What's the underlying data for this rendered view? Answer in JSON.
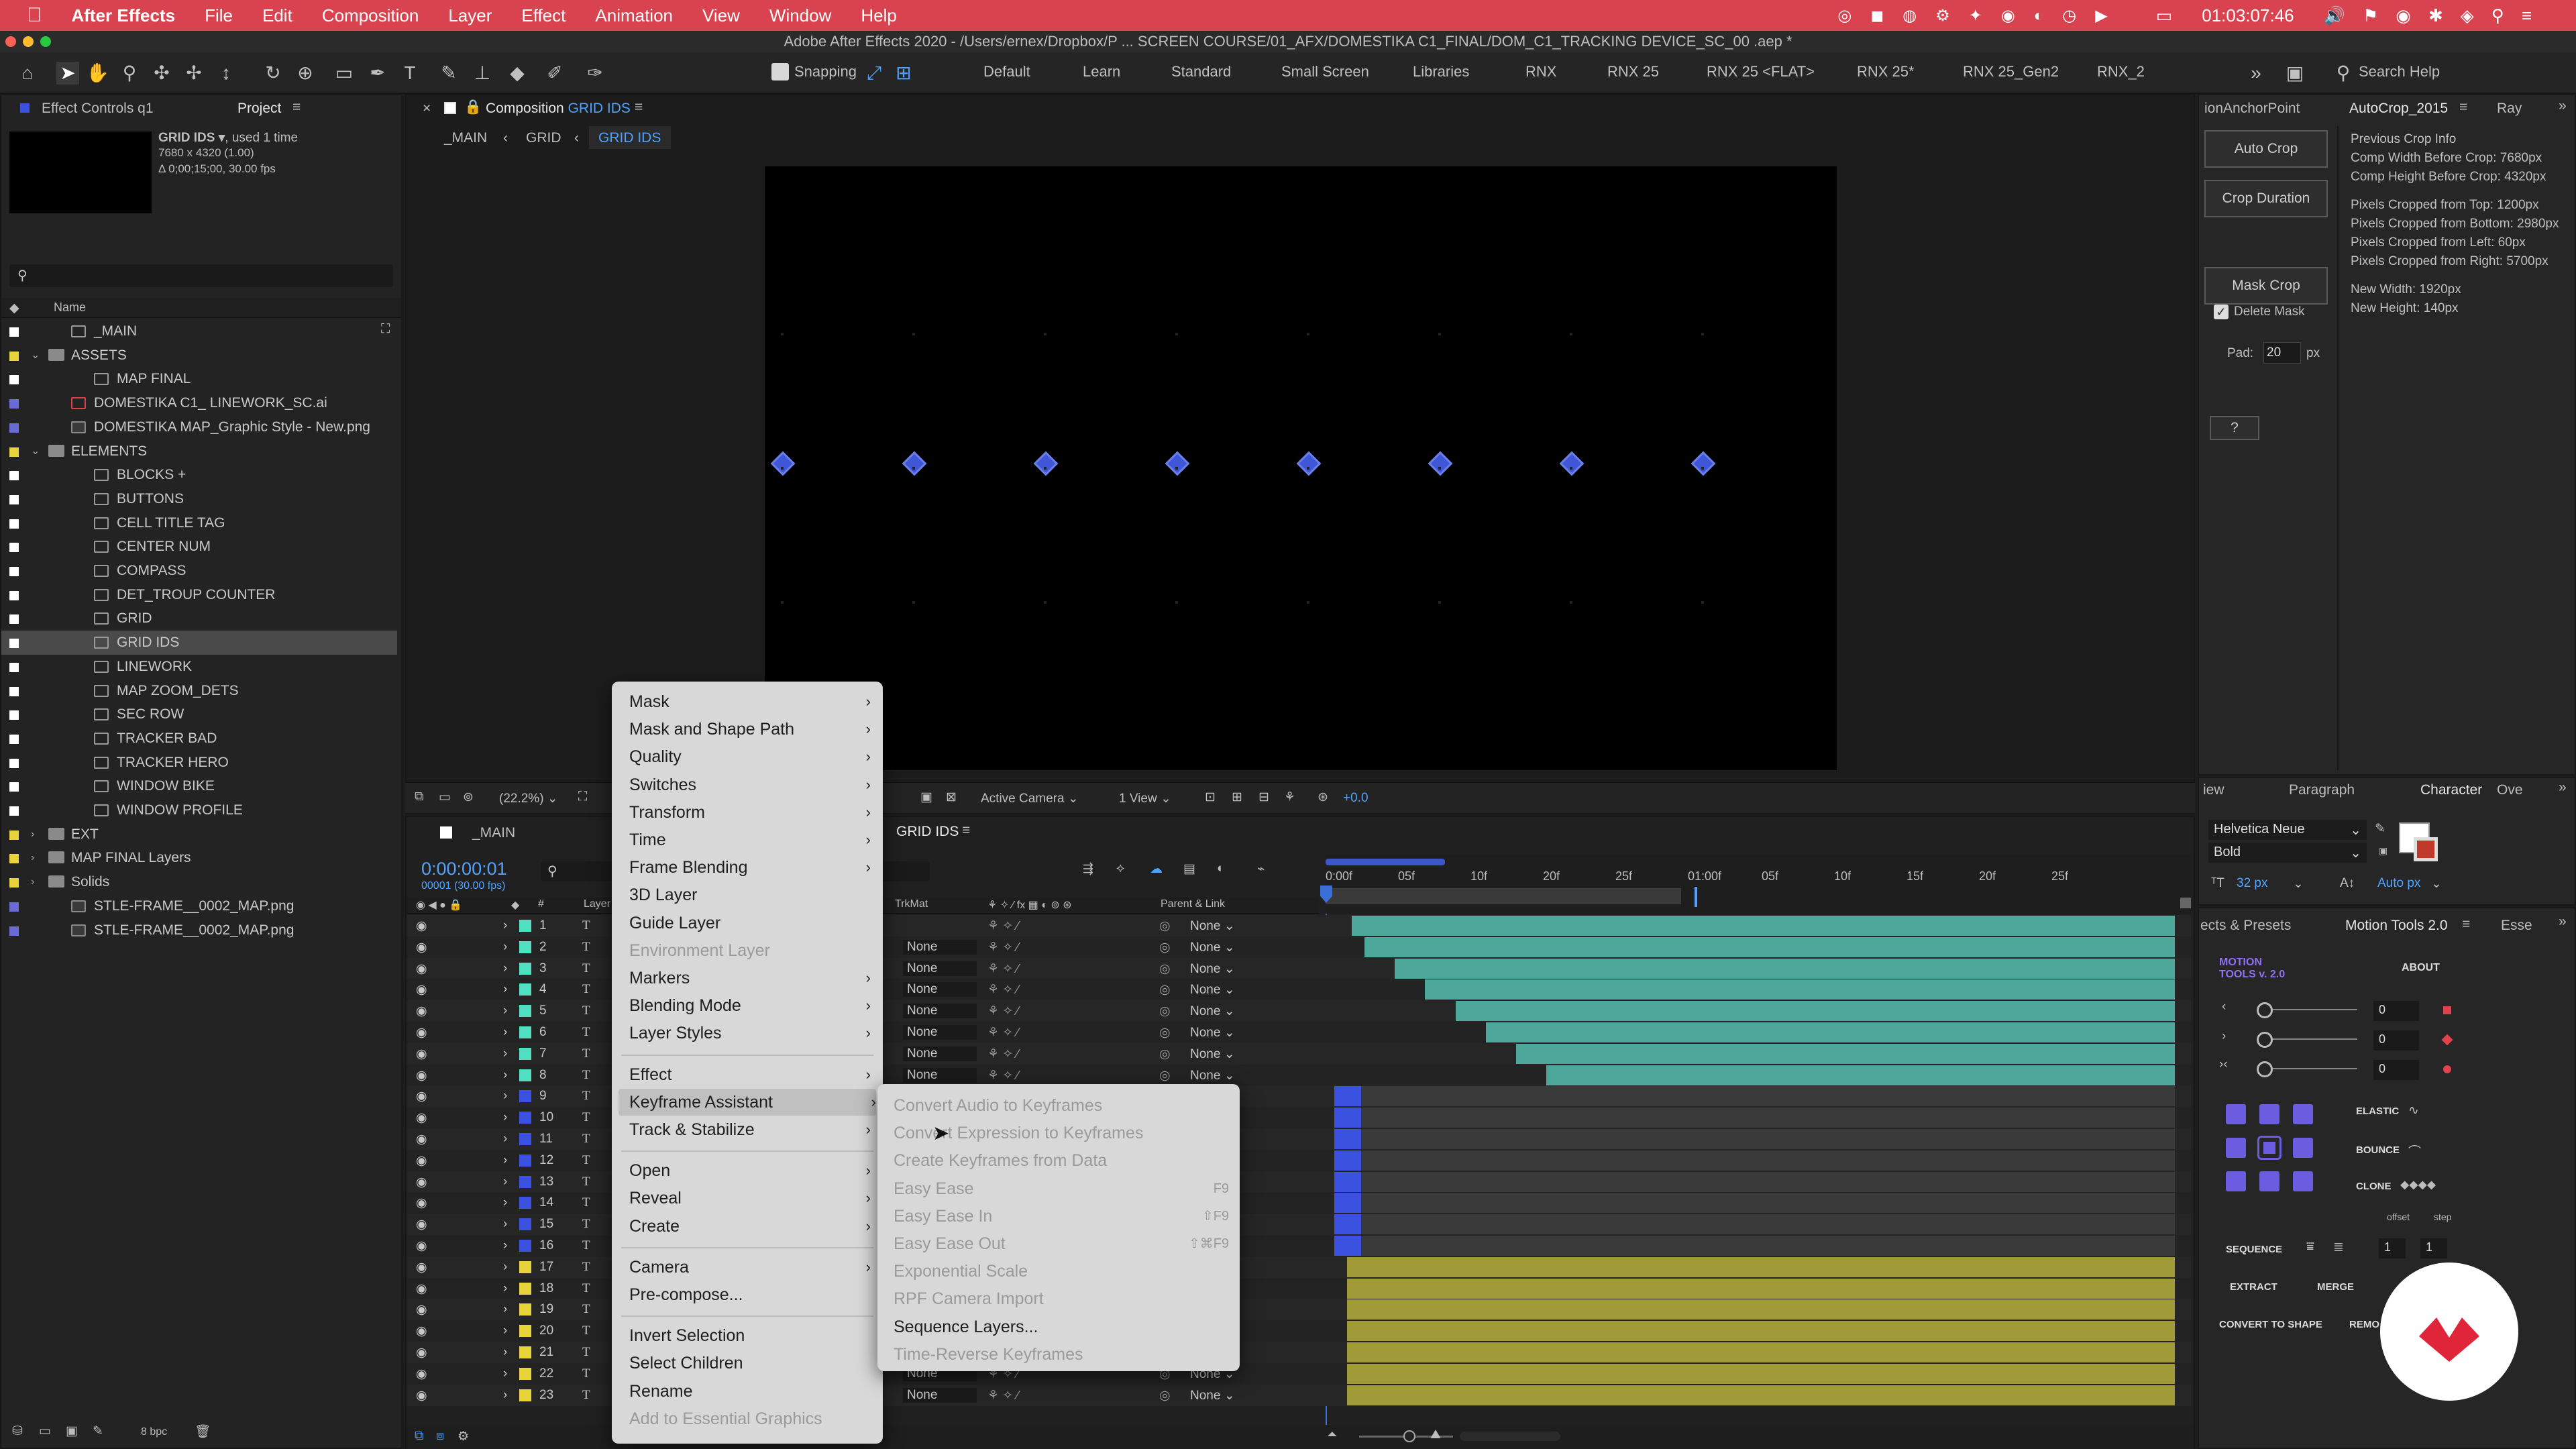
{
  "menubar": {
    "app": "After Effects",
    "items": [
      "File",
      "Edit",
      "Composition",
      "Layer",
      "Effect",
      "Animation",
      "View",
      "Window",
      "Help"
    ],
    "clock": "01:03:07:46"
  },
  "titlebar": {
    "title": "Adobe After Effects 2020 - /Users/ernex/Dropbox/P ... SCREEN COURSE/01_AFX/DOMESTIKA C1_FINAL/DOM_C1_TRACKING DEVICE_SC_00 .aep *"
  },
  "toolbar": {
    "snapping": "Snapping",
    "workspaces": [
      "Default",
      "Learn",
      "Standard",
      "Small Screen",
      "Libraries",
      "RNX",
      "RNX 25",
      "RNX 25 <FLAT>",
      "RNX 25*",
      "RNX 25_Gen2",
      "RNX_2"
    ],
    "search_placeholder": "Search Help"
  },
  "project": {
    "tabs": [
      "Effect Controls q1",
      "Project"
    ],
    "selected_name": "GRID IDS ▾",
    "selected_used": ", used 1 time",
    "selected_info1": "7680 x 4320 (1.00)",
    "selected_info2": "Δ 0;00;15;00, 30.00 fps",
    "search_placeholder": "",
    "col_name": "Name",
    "items": [
      {
        "name": "_MAIN",
        "indent": 1,
        "color": "#ffffff",
        "type": "comp"
      },
      {
        "name": "ASSETS",
        "indent": 0,
        "color": "#e8d33a",
        "type": "folder",
        "open": true
      },
      {
        "name": "MAP FINAL",
        "indent": 2,
        "color": "#ffffff",
        "type": "comp"
      },
      {
        "name": "DOMESTIKA C1_ LINEWORK_SC.ai",
        "indent": 1,
        "color": "#6b6bd8",
        "type": "ai"
      },
      {
        "name": "DOMESTIKA MAP_Graphic Style - New.png",
        "indent": 1,
        "color": "#6b6bd8",
        "type": "img"
      },
      {
        "name": "ELEMENTS",
        "indent": 0,
        "color": "#e8d33a",
        "type": "folder",
        "open": true
      },
      {
        "name": "BLOCKS +",
        "indent": 2,
        "color": "#ffffff",
        "type": "comp"
      },
      {
        "name": "BUTTONS",
        "indent": 2,
        "color": "#ffffff",
        "type": "comp"
      },
      {
        "name": "CELL TITLE TAG",
        "indent": 2,
        "color": "#ffffff",
        "type": "comp"
      },
      {
        "name": "CENTER NUM",
        "indent": 2,
        "color": "#ffffff",
        "type": "comp"
      },
      {
        "name": "COMPASS",
        "indent": 2,
        "color": "#ffffff",
        "type": "comp"
      },
      {
        "name": "DET_TROUP COUNTER",
        "indent": 2,
        "color": "#ffffff",
        "type": "comp"
      },
      {
        "name": "GRID",
        "indent": 2,
        "color": "#ffffff",
        "type": "comp"
      },
      {
        "name": "GRID IDS",
        "indent": 2,
        "color": "#ffffff",
        "type": "comp",
        "selected": true
      },
      {
        "name": "LINEWORK",
        "indent": 2,
        "color": "#ffffff",
        "type": "comp"
      },
      {
        "name": "MAP ZOOM_DETS",
        "indent": 2,
        "color": "#ffffff",
        "type": "comp"
      },
      {
        "name": "SEC ROW",
        "indent": 2,
        "color": "#ffffff",
        "type": "comp"
      },
      {
        "name": "TRACKER BAD",
        "indent": 2,
        "color": "#ffffff",
        "type": "comp"
      },
      {
        "name": "TRACKER HERO",
        "indent": 2,
        "color": "#ffffff",
        "type": "comp"
      },
      {
        "name": "WINDOW BIKE",
        "indent": 2,
        "color": "#ffffff",
        "type": "comp"
      },
      {
        "name": "WINDOW PROFILE",
        "indent": 2,
        "color": "#ffffff",
        "type": "comp"
      },
      {
        "name": "EXT",
        "indent": 0,
        "color": "#e8d33a",
        "type": "folder"
      },
      {
        "name": "MAP FINAL Layers",
        "indent": 0,
        "color": "#e8d33a",
        "type": "folder"
      },
      {
        "name": "Solids",
        "indent": 0,
        "color": "#e8d33a",
        "type": "folder"
      },
      {
        "name": "STLE-FRAME__0002_MAP.png",
        "indent": 1,
        "color": "#6b6bd8",
        "type": "img"
      },
      {
        "name": "STLE-FRAME__0002_MAP.png",
        "indent": 1,
        "color": "#6b6bd8",
        "type": "img"
      }
    ],
    "bpc": "8 bpc"
  },
  "composition": {
    "tab_label": "Composition",
    "tab_name": "GRID IDS",
    "breadcrumbs": [
      "_MAIN",
      "GRID",
      "GRID IDS"
    ],
    "zoom": "(22.2%)",
    "camera": "Active Camera",
    "view": "1 View",
    "exposure": "+0.0"
  },
  "timeline": {
    "tabs": [
      "_MAIN",
      "GRID IDS"
    ],
    "timecode": "0:00:00:01",
    "frame_info": "00001 (30.00 fps)",
    "col_num": "#",
    "col_layer": "Layer",
    "col_trkmat": "TrkMat",
    "col_parent": "Parent & Link",
    "ruler": [
      "0:00f",
      "05f",
      "10f",
      "20f",
      "25f",
      "01:00f",
      "05f",
      "10f",
      "15f",
      "20f",
      "25f"
    ],
    "rows": [
      {
        "n": "1",
        "color": "#4fe0c0",
        "trk": "",
        "parent": "None",
        "bar_start": 0.03,
        "bar_color": "#4da89b"
      },
      {
        "n": "2",
        "color": "#4fe0c0",
        "trk": "None",
        "parent": "None",
        "bar_start": 0.045,
        "bar_color": "#4da89b"
      },
      {
        "n": "3",
        "color": "#4fe0c0",
        "trk": "None",
        "parent": "None",
        "bar_start": 0.08,
        "bar_color": "#4da89b"
      },
      {
        "n": "4",
        "color": "#4fe0c0",
        "trk": "None",
        "parent": "None",
        "bar_start": 0.115,
        "bar_color": "#4da89b"
      },
      {
        "n": "5",
        "color": "#4fe0c0",
        "trk": "None",
        "parent": "None",
        "bar_start": 0.15,
        "bar_color": "#4da89b"
      },
      {
        "n": "6",
        "color": "#4fe0c0",
        "trk": "None",
        "parent": "None",
        "bar_start": 0.185,
        "bar_color": "#4da89b"
      },
      {
        "n": "7",
        "color": "#4fe0c0",
        "trk": "None",
        "parent": "None",
        "bar_start": 0.22,
        "bar_color": "#4da89b"
      },
      {
        "n": "8",
        "color": "#4fe0c0",
        "trk": "None",
        "parent": "None",
        "bar_start": 0.255,
        "bar_color": "#4da89b"
      },
      {
        "n": "9",
        "color": "#3b52e0",
        "trk": "",
        "parent": "",
        "bar_start": 0.01,
        "bar_color": "#3b52e0",
        "short": true
      },
      {
        "n": "10",
        "color": "#3b52e0",
        "trk": "",
        "parent": "",
        "bar_start": 0.01,
        "bar_color": "#3b52e0",
        "short": true
      },
      {
        "n": "11",
        "color": "#3b52e0",
        "trk": "",
        "parent": "",
        "bar_start": 0.01,
        "bar_color": "#3b52e0",
        "short": true
      },
      {
        "n": "12",
        "color": "#3b52e0",
        "trk": "",
        "parent": "",
        "bar_start": 0.01,
        "bar_color": "#3b52e0",
        "short": true
      },
      {
        "n": "13",
        "color": "#3b52e0",
        "trk": "",
        "parent": "",
        "bar_start": 0.01,
        "bar_color": "#3b52e0",
        "short": true
      },
      {
        "n": "14",
        "color": "#3b52e0",
        "trk": "",
        "parent": "",
        "bar_start": 0.01,
        "bar_color": "#3b52e0",
        "short": true
      },
      {
        "n": "15",
        "color": "#3b52e0",
        "trk": "",
        "parent": "",
        "bar_start": 0.01,
        "bar_color": "#3b52e0",
        "short": true
      },
      {
        "n": "16",
        "color": "#3b52e0",
        "trk": "",
        "parent": "",
        "bar_start": 0.01,
        "bar_color": "#3b52e0",
        "short": true
      },
      {
        "n": "17",
        "color": "#e8d33a",
        "trk": "",
        "parent": "",
        "bar_start": 0.025,
        "bar_color": "#a09a38"
      },
      {
        "n": "18",
        "color": "#e8d33a",
        "trk": "",
        "parent": "",
        "bar_start": 0.025,
        "bar_color": "#a09a38"
      },
      {
        "n": "19",
        "color": "#e8d33a",
        "trk": "",
        "parent": "",
        "bar_start": 0.025,
        "bar_color": "#a09a38"
      },
      {
        "n": "20",
        "color": "#e8d33a",
        "trk": "",
        "parent": "",
        "bar_start": 0.025,
        "bar_color": "#a09a38"
      },
      {
        "n": "21",
        "color": "#e8d33a",
        "trk": "",
        "parent": "",
        "bar_start": 0.025,
        "bar_color": "#a09a38"
      },
      {
        "n": "22",
        "color": "#e8d33a",
        "trk": "None",
        "parent": "None",
        "bar_start": 0.025,
        "bar_color": "#a09a38"
      },
      {
        "n": "23",
        "color": "#e8d33a",
        "trk": "None",
        "parent": "None",
        "bar_start": 0.025,
        "bar_color": "#a09a38"
      }
    ]
  },
  "context_menu": {
    "items": [
      {
        "label": "Mask",
        "sub": true
      },
      {
        "label": "Mask and Shape Path",
        "sub": true
      },
      {
        "label": "Quality",
        "sub": true
      },
      {
        "label": "Switches",
        "sub": true
      },
      {
        "label": "Transform",
        "sub": true
      },
      {
        "label": "Time",
        "sub": true
      },
      {
        "label": "Frame Blending",
        "sub": true
      },
      {
        "label": "3D Layer"
      },
      {
        "label": "Guide Layer"
      },
      {
        "label": "Environment Layer",
        "disabled": true
      },
      {
        "label": "Markers",
        "sub": true
      },
      {
        "label": "Blending Mode",
        "sub": true
      },
      {
        "label": "Layer Styles",
        "sub": true
      },
      {
        "sep": true
      },
      {
        "label": "Effect",
        "sub": true
      },
      {
        "label": "Keyframe Assistant",
        "sub": true,
        "highlight": true
      },
      {
        "label": "Track & Stabilize",
        "sub": true
      },
      {
        "sep": true
      },
      {
        "label": "Open",
        "sub": true
      },
      {
        "label": "Reveal",
        "sub": true
      },
      {
        "label": "Create",
        "sub": true
      },
      {
        "sep": true
      },
      {
        "label": "Camera",
        "sub": true
      },
      {
        "label": "Pre-compose..."
      },
      {
        "sep": true
      },
      {
        "label": "Invert Selection"
      },
      {
        "label": "Select Children"
      },
      {
        "label": "Rename"
      },
      {
        "label": "Add to Essential Graphics",
        "disabled": true
      }
    ]
  },
  "submenu": {
    "items": [
      {
        "label": "Convert Audio to Keyframes",
        "enabled": false,
        "shortcut": ""
      },
      {
        "label": "Convert Expression to Keyframes",
        "enabled": false,
        "shortcut": ""
      },
      {
        "label": "Create Keyframes from Data",
        "enabled": false,
        "shortcut": ""
      },
      {
        "label": "Easy Ease",
        "enabled": false,
        "shortcut": "F9"
      },
      {
        "label": "Easy Ease In",
        "enabled": false,
        "shortcut": "⇧F9"
      },
      {
        "label": "Easy Ease Out",
        "enabled": false,
        "shortcut": "⇧⌘F9"
      },
      {
        "label": "Exponential Scale",
        "enabled": false,
        "shortcut": ""
      },
      {
        "label": "RPF Camera Import",
        "enabled": false,
        "shortcut": ""
      },
      {
        "label": "Sequence Layers...",
        "enabled": true,
        "shortcut": ""
      },
      {
        "label": "Time-Reverse Keyframes",
        "enabled": false,
        "shortcut": ""
      }
    ]
  },
  "autocrop": {
    "tabs": [
      "ionAnchorPoint",
      "AutoCrop_2015",
      "Ray"
    ],
    "btn_auto": "Auto Crop",
    "btn_duration": "Crop Duration",
    "btn_mask": "Mask Crop",
    "delete_mask": "Delete Mask",
    "pad_label": "Pad:",
    "pad_value": "20",
    "pad_unit": "px",
    "help": "?",
    "info": [
      "Previous Crop Info",
      "Comp Width Before Crop: 7680px",
      "Comp Height Before Crop: 4320px",
      "",
      "Pixels Cropped from Top: 1200px",
      "Pixels Cropped from Bottom: 2980px",
      "Pixels Cropped from Left: 60px",
      "Pixels Cropped from Right: 5700px",
      "",
      "New Width: 1920px",
      "New Height: 140px"
    ]
  },
  "character": {
    "tabs": [
      "iew",
      "Paragraph",
      "Character",
      "Ove"
    ],
    "font": "Helvetica Neue",
    "style": "Bold",
    "size": "32 px",
    "leading": "Auto px"
  },
  "motion_tools": {
    "tabs": [
      "ects & Presets",
      "Motion Tools 2.0",
      "Esse"
    ],
    "logo": "MOTION TOOLS v. 2.0",
    "about": "ABOUT",
    "sliders": [
      "0",
      "0",
      "0"
    ],
    "elastic": "ELASTIC",
    "bounce": "BOUNCE",
    "clone": "CLONE",
    "offset": "offset",
    "step": "step",
    "sequence": "SEQUENCE",
    "seq_val1": "1",
    "seq_val2": "1",
    "extract": "EXTRACT",
    "merge": "MERGE",
    "convert": "CONVERT TO SHAPE",
    "remove": "REMO"
  },
  "colors": {
    "menubar": "#d8434f",
    "accent_blue": "#3f56d8",
    "teal_bar": "#4da89b",
    "yellow_bar": "#a09a38"
  }
}
